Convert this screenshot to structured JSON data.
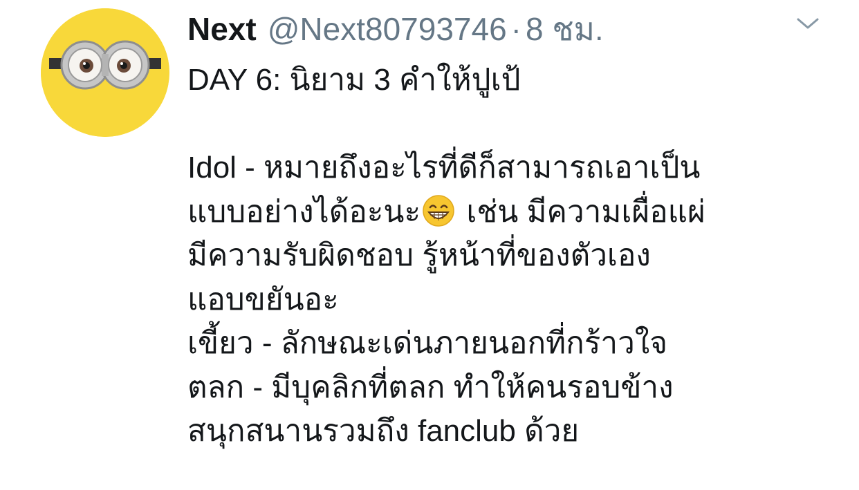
{
  "tweet": {
    "display_name": "Next",
    "handle": "@Next80793746",
    "separator": "·",
    "time": "8 ชม.",
    "menu_icon": "chevron-down-icon",
    "avatar_icon": "minion-goggles-avatar",
    "text": {
      "line1": "DAY 6: นิยาม 3 คำให้ปูเป้",
      "line2": "Idol - หมายถึงอะไรที่ดีก็สามารถเอาเป็น",
      "line3a": "แบบอย่างได้อะนะ",
      "emoji": "grinning-face-with-smiling-eyes",
      "line3b": " เช่น มีความเผื่อแผ่",
      "line4": "มีความรับผิดชอบ รู้หน้าที่ของตัวเอง",
      "line5": "แอบขยันอะ",
      "line6": "เขี้ยว - ลักษณะเด่นภายนอกที่กร้าวใจ",
      "line7": "ตลก - มีบุคลิกที่ตลก ทำให้คนรอบข้าง",
      "line8": "สนุกสนานรวมถึง fanclub ด้วย"
    },
    "colors": {
      "avatar_bg": "#f8d83a",
      "secondary_text": "#657786",
      "primary_text": "#14171a"
    }
  }
}
